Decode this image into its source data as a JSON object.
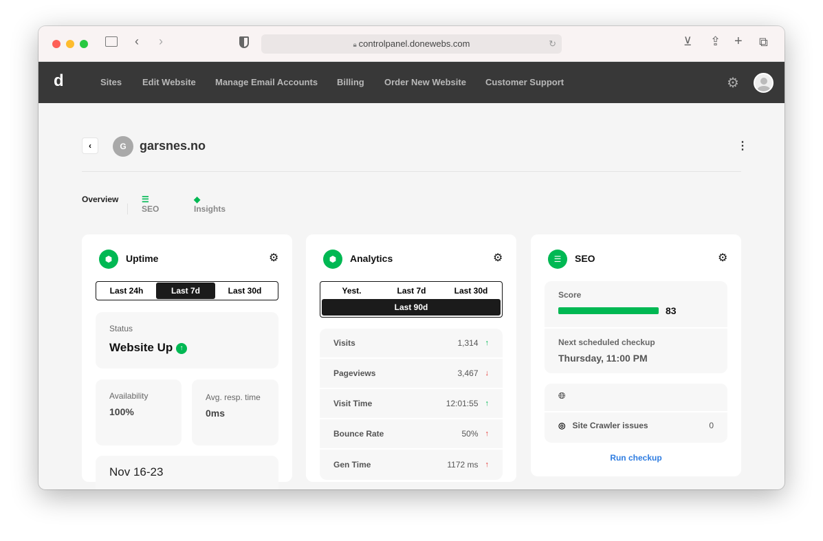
{
  "browser": {
    "url": "controlpanel.donewebs.com"
  },
  "nav": {
    "logo": "d",
    "items": [
      "Sites",
      "Edit Website",
      "Manage Email Accounts",
      "Billing",
      "Order New Website",
      "Customer Support"
    ]
  },
  "site": {
    "initial": "G",
    "name": "garsnes.no"
  },
  "tabs": [
    "Overview",
    "SEO",
    "Insights"
  ],
  "uptime": {
    "title": "Uptime",
    "ranges": [
      "Last 24h",
      "Last 7d",
      "Last 30d"
    ],
    "status_label": "Status",
    "status": "Website Up",
    "availability_label": "Availability",
    "availability": "100%",
    "resp_label": "Avg. resp. time",
    "resp": "0ms",
    "period": "Nov 16-23"
  },
  "analytics": {
    "title": "Analytics",
    "ranges": [
      "Yest.",
      "Last 7d",
      "Last 30d",
      "Last 90d"
    ],
    "rows": [
      {
        "label": "Visits",
        "value": "1,314",
        "trend": "up"
      },
      {
        "label": "Pageviews",
        "value": "3,467",
        "trend": "down"
      },
      {
        "label": "Visit Time",
        "value": "12:01:55",
        "trend": "up"
      },
      {
        "label": "Bounce Rate",
        "value": "50%",
        "trend": "up-red"
      },
      {
        "label": "Gen Time",
        "value": "1172 ms",
        "trend": "up-red"
      }
    ]
  },
  "seo": {
    "title": "SEO",
    "score_label": "Score",
    "score": "83",
    "next_label": "Next scheduled checkup",
    "next": "Thursday, 11:00 PM",
    "crawler_label": "Site Crawler issues",
    "crawler": "0",
    "run": "Run checkup"
  },
  "colors": {
    "accent": "#00b853",
    "nav": "#383838",
    "link": "#2f7de1"
  }
}
